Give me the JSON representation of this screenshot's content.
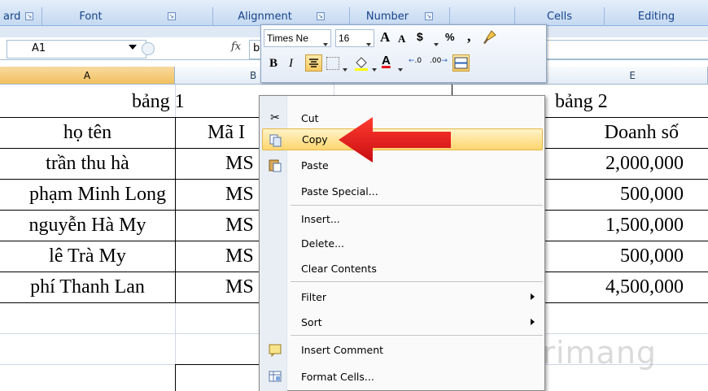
{
  "ribbon": {
    "groups": [
      "ard",
      "Font",
      "Alignment",
      "Number",
      "Cells",
      "Editing"
    ]
  },
  "formula_bar": {
    "name_box": "A1",
    "fx": "fx",
    "content": "b"
  },
  "columns": [
    "A",
    "B",
    "E"
  ],
  "sheet": {
    "title_left": "bảng 1",
    "title_right": "bảng 2",
    "header_name": "họ tên",
    "header_code": "Mã I",
    "header_sales": "Doanh số",
    "rows": [
      {
        "name": "trần thu hà",
        "code": "MS",
        "sales": "2,000,000"
      },
      {
        "name": "phạm Minh Long",
        "code": "MS",
        "sales": "500,000"
      },
      {
        "name": "nguyễn Hà My",
        "code": "MS",
        "sales": "1,500,000"
      },
      {
        "name": "lê Trà My",
        "code": "MS",
        "sales": "500,000"
      },
      {
        "name": "phí Thanh Lan",
        "code": "MS",
        "sales": "4,500,000"
      }
    ]
  },
  "mini_toolbar": {
    "font": "Times Ne",
    "size": "16",
    "bold": "B",
    "italic": "I",
    "grow": "A",
    "shrink": "A",
    "currency": "$",
    "percent": "%",
    "comma": ",",
    "font_color": "A",
    "inc_decimal": ".0",
    "dec_decimal": ".00"
  },
  "context_menu": {
    "items": [
      {
        "label": "Cut",
        "icon": "scissors-icon"
      },
      {
        "label": "Copy",
        "icon": "copy-icon"
      },
      {
        "label": "Paste",
        "icon": "paste-icon"
      },
      {
        "label": "Paste Special...",
        "icon": ""
      },
      {
        "label": "Insert...",
        "icon": ""
      },
      {
        "label": "Delete...",
        "icon": ""
      },
      {
        "label": "Clear Contents",
        "icon": ""
      },
      {
        "label": "Filter",
        "icon": ""
      },
      {
        "label": "Sort",
        "icon": ""
      },
      {
        "label": "Insert Comment",
        "icon": "comment-icon"
      },
      {
        "label": "Format Cells...",
        "icon": "format-cells-icon"
      }
    ]
  },
  "watermark": "uantrimang",
  "colors": {
    "highlight": "#ffd66e",
    "arrow": "#e8141b",
    "selected_col": "#f1c15f"
  }
}
